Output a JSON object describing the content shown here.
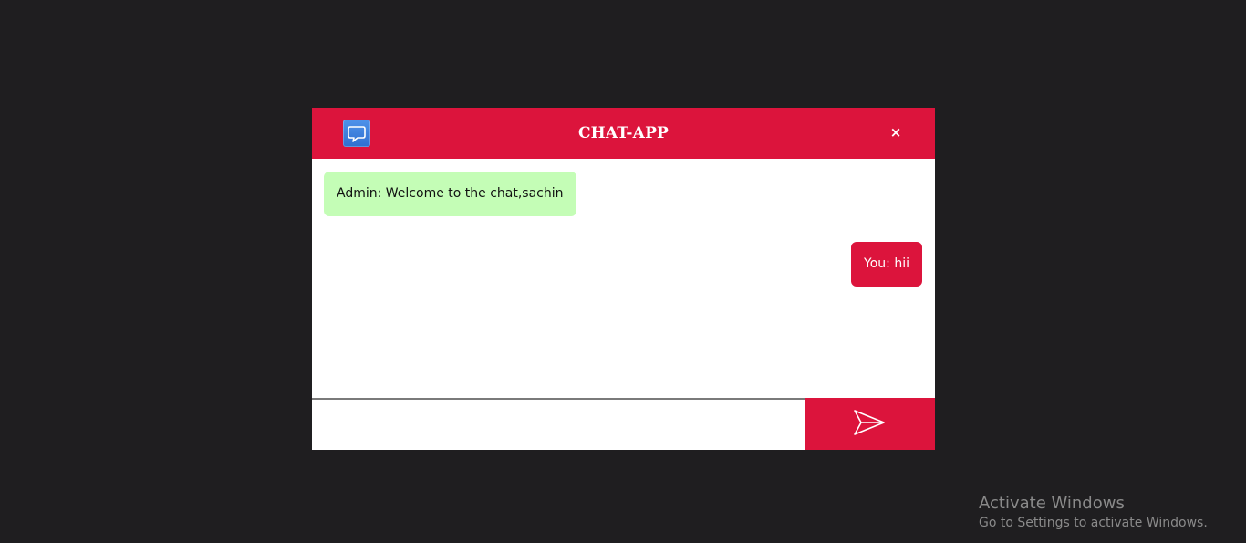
{
  "header": {
    "title": "CHAT-APP",
    "close_label": "×",
    "logo_icon": "chat-bubble-icon"
  },
  "messages": [
    {
      "sender": "admin",
      "text": "Admin: Welcome to the chat,sachin"
    },
    {
      "sender": "you",
      "text": "You: hii"
    }
  ],
  "composer": {
    "input_value": "",
    "input_placeholder": "",
    "send_icon": "send-icon"
  },
  "watermark": {
    "title": "Activate Windows",
    "subtitle": "Go to Settings to activate Windows."
  },
  "colors": {
    "accent": "#dc143c",
    "admin_bubble": "#c4fdb6",
    "background": "#1f1e20"
  }
}
